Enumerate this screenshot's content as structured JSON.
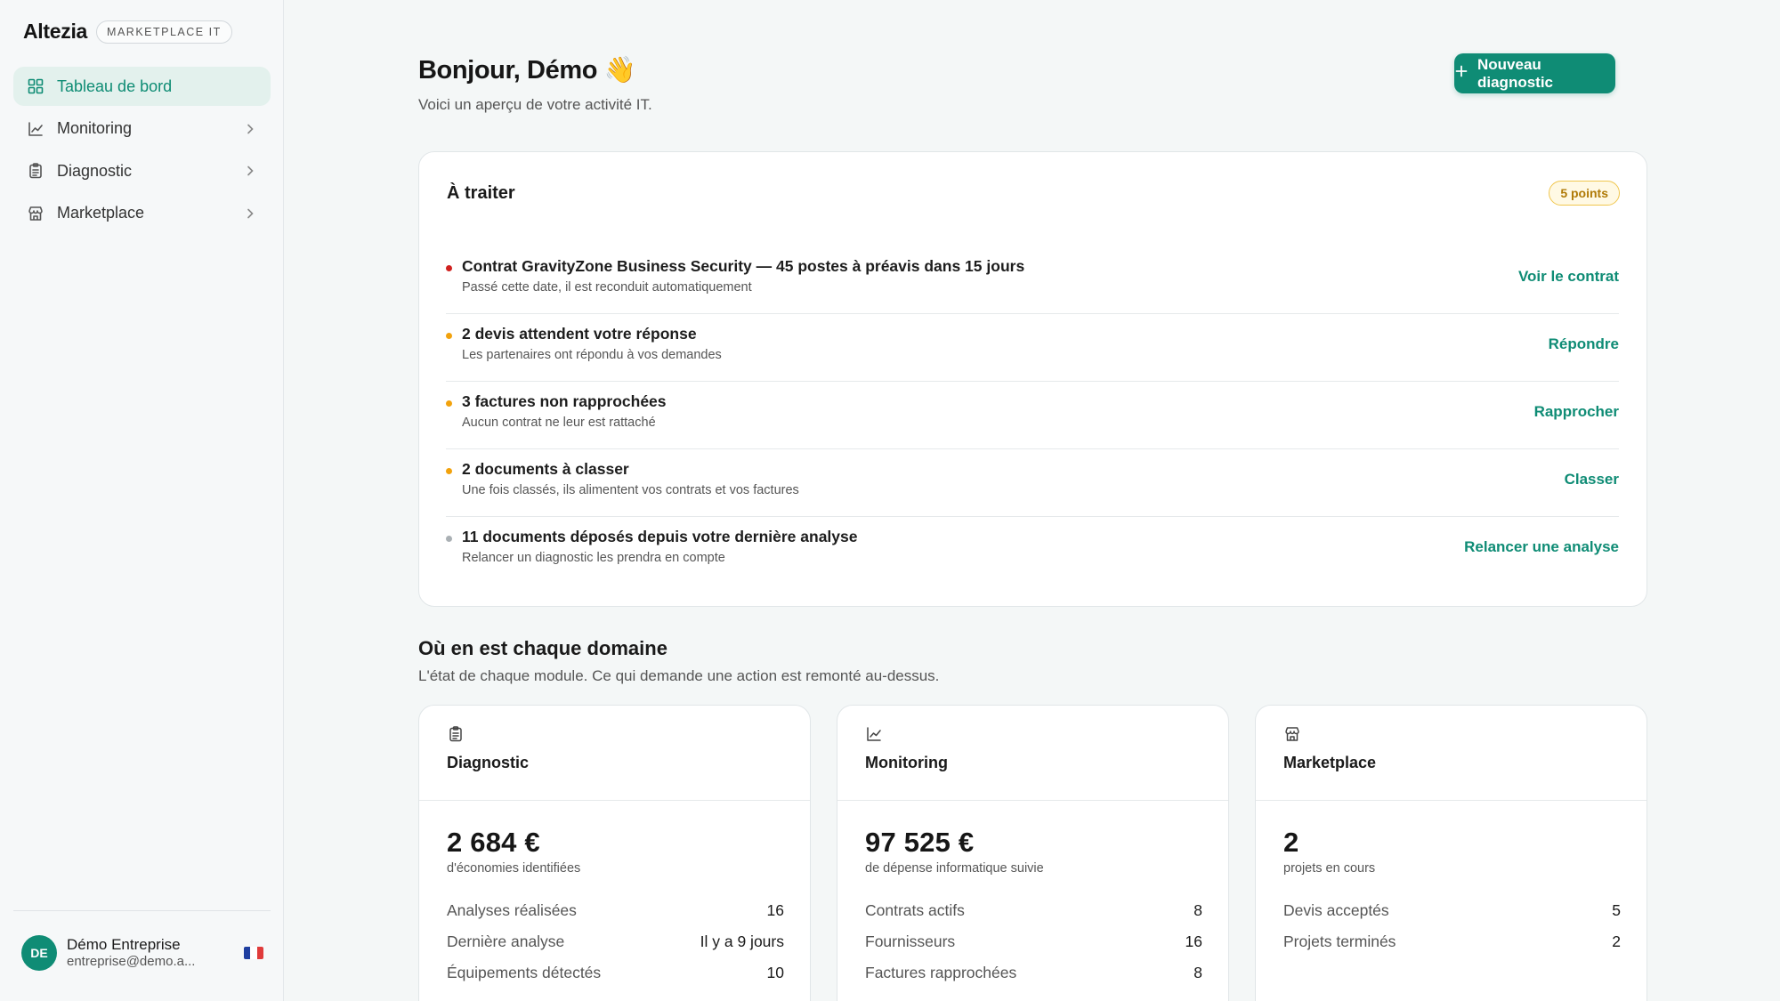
{
  "brand": {
    "name": "Altezia",
    "tag": "MARKETPLACE IT"
  },
  "sidebar": {
    "items": [
      {
        "label": "Tableau de bord",
        "icon": "grid-icon",
        "active": true
      },
      {
        "label": "Monitoring",
        "icon": "line-chart-icon"
      },
      {
        "label": "Diagnostic",
        "icon": "clipboard-icon"
      },
      {
        "label": "Marketplace",
        "icon": "store-icon"
      }
    ]
  },
  "user": {
    "initials": "DE",
    "name": "Démo Entreprise",
    "email": "entreprise@demo.a..."
  },
  "header": {
    "greeting": "Bonjour, Démo 👋",
    "subtitle": "Voici un aperçu de votre activité IT.",
    "cta_label": "Nouveau diagnostic"
  },
  "todo": {
    "title": "À traiter",
    "badge": "5 points",
    "items": [
      {
        "title": "Contrat GravityZone Business Security — 45 postes à préavis dans 15 jours",
        "sub": "Passé cette date, il est reconduit automatiquement",
        "action": "Voir le contrat",
        "color": "#d0211f"
      },
      {
        "title": "2 devis attendent votre réponse",
        "sub": "Les partenaires ont répondu à vos demandes",
        "action": "Répondre",
        "color": "#f2a20d"
      },
      {
        "title": "3 factures non rapprochées",
        "sub": "Aucun contrat ne leur est rattaché",
        "action": "Rapprocher",
        "color": "#f2a20d"
      },
      {
        "title": "2 documents à classer",
        "sub": "Une fois classés, ils alimentent vos contrats et vos factures",
        "action": "Classer",
        "color": "#f2a20d"
      },
      {
        "title": "11 documents déposés depuis votre dernière analyse",
        "sub": "Relancer un diagnostic les prendra en compte",
        "action": "Relancer une analyse",
        "color": "#aab0b4"
      }
    ]
  },
  "domains": {
    "title": "Où en est chaque domaine",
    "subtitle": "L'état de chaque module. Ce qui demande une action est remonté au-dessus.",
    "cards": [
      {
        "name": "Diagnostic",
        "icon": "clipboard-icon",
        "big": "2 684 €",
        "caption": "d'économies identifiées",
        "rows": [
          {
            "k": "Analyses réalisées",
            "v": "16"
          },
          {
            "k": "Dernière analyse",
            "v": "Il y a 9 jours"
          },
          {
            "k": "Équipements détectés",
            "v": "10"
          }
        ]
      },
      {
        "name": "Monitoring",
        "icon": "line-chart-icon",
        "big": "97 525 €",
        "caption": "de dépense informatique suivie",
        "rows": [
          {
            "k": "Contrats actifs",
            "v": "8"
          },
          {
            "k": "Fournisseurs",
            "v": "16"
          },
          {
            "k": "Factures rapprochées",
            "v": "8"
          }
        ]
      },
      {
        "name": "Marketplace",
        "icon": "store-icon",
        "big": "2",
        "caption": "projets en cours",
        "rows": [
          {
            "k": "Devis acceptés",
            "v": "5"
          },
          {
            "k": "Projets terminés",
            "v": "2"
          }
        ]
      }
    ]
  },
  "colors": {
    "accent": "#0f8c75",
    "accent_bg": "#e3f1ed",
    "badge_border": "#f0c64e"
  }
}
